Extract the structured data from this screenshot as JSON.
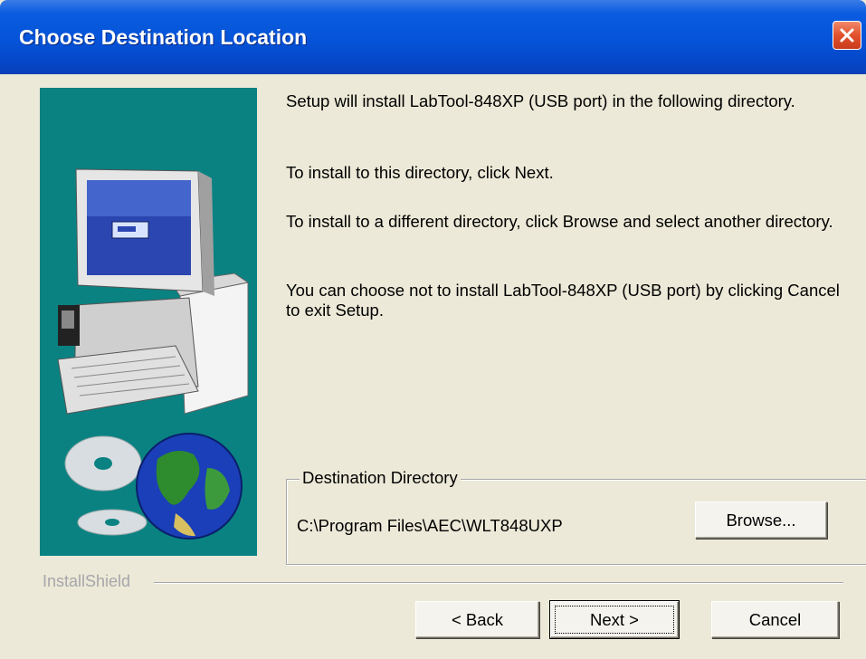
{
  "window": {
    "title": "Choose Destination Location"
  },
  "content": {
    "paragraphs": [
      "Setup will install LabTool-848XP (USB port) in the following directory.",
      "To install to this directory, click Next.",
      "To install to a different directory, click Browse and select another directory.",
      "You can choose not to install LabTool-848XP (USB port) by clicking Cancel to exit Setup."
    ]
  },
  "destination": {
    "group_label": "Destination Directory",
    "path": "C:\\Program Files\\AEC\\WLT848UXP",
    "browse_label": "Browse..."
  },
  "footer": {
    "brand": "InstallShield",
    "back_label": "< Back",
    "next_label": "Next >",
    "cancel_label": "Cancel"
  },
  "colors": {
    "titlebar": "#0553D8",
    "background": "#ECE9D8",
    "banner": "#0A8282",
    "close_button": "#E2512C"
  },
  "icons": {
    "close": "close-x-icon",
    "banner": "computer-globe-illustration"
  }
}
